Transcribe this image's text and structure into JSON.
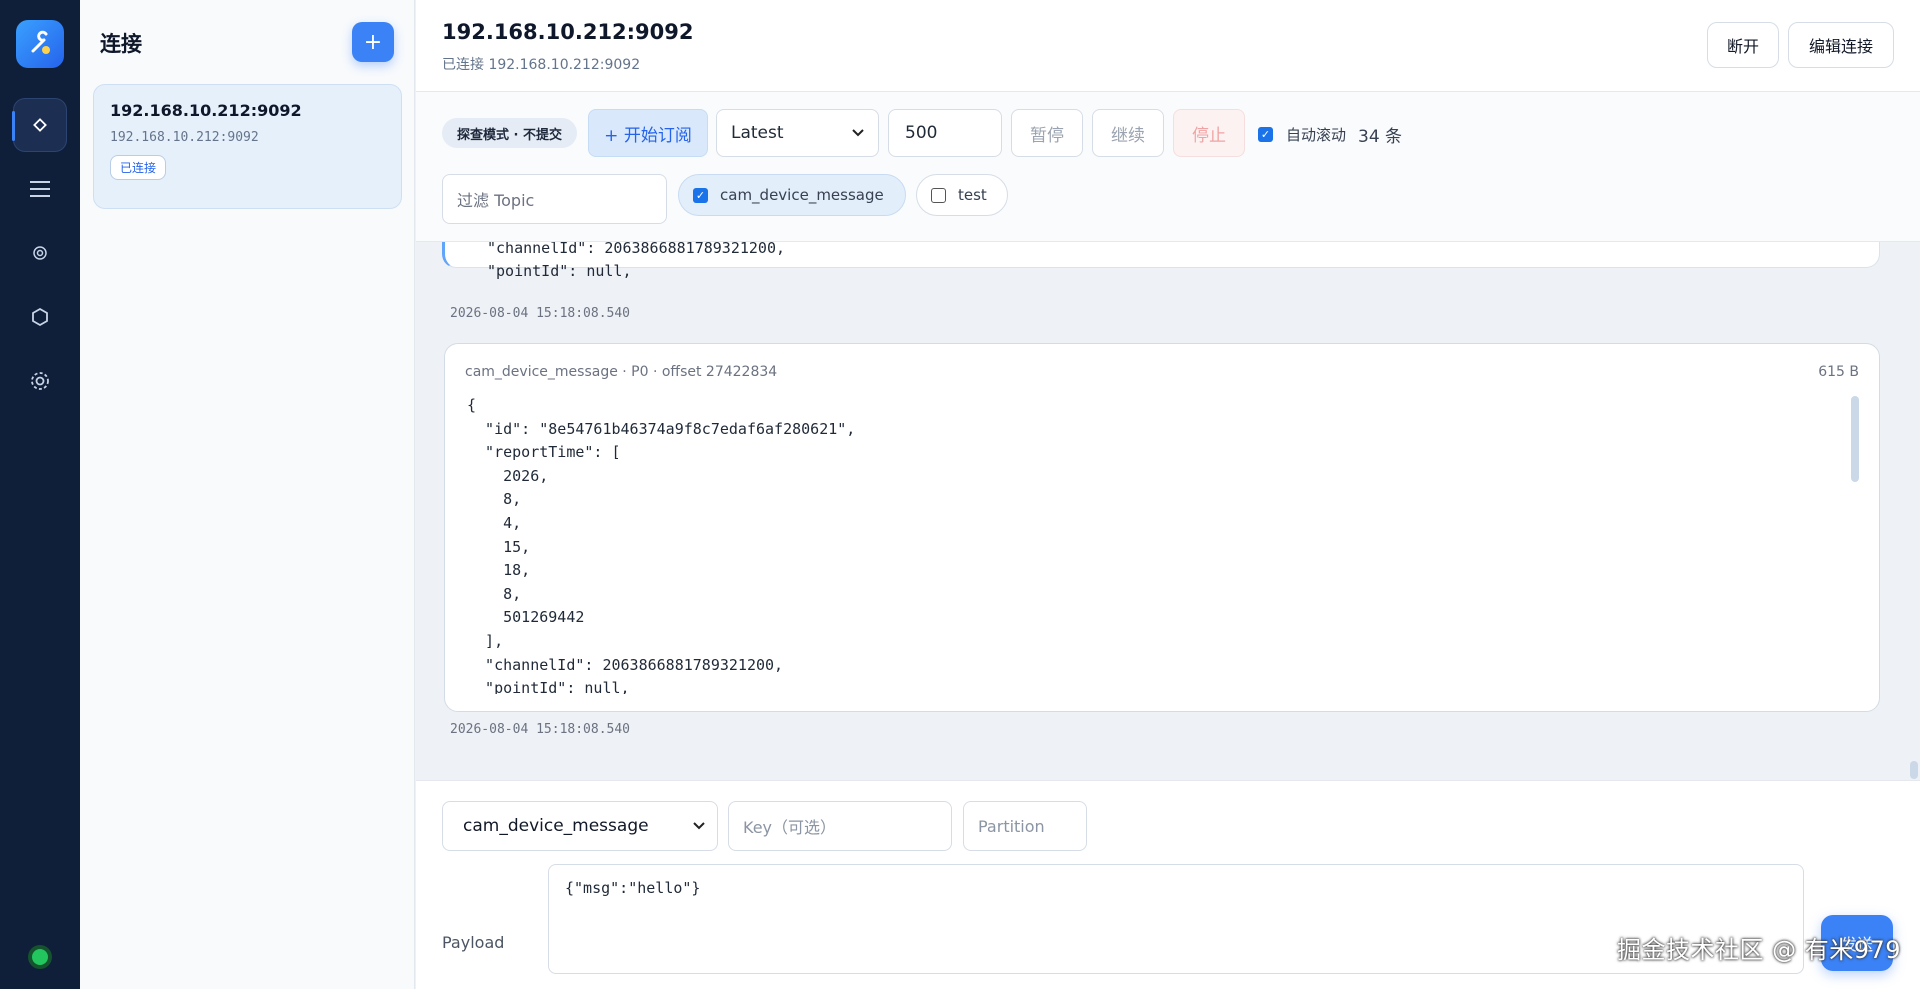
{
  "rail": {
    "items": [
      "connections-icon",
      "list-icon",
      "target-icon",
      "hexagon-icon",
      "settings-icon"
    ]
  },
  "sidebar": {
    "title": "连接",
    "add_label": "+",
    "connection": {
      "name": "192.168.10.212:9092",
      "address": "192.168.10.212:9092",
      "status": "已连接"
    }
  },
  "header": {
    "title": "192.168.10.212:9092",
    "subtitle": "已连接 192.168.10.212:9092",
    "disconnect_label": "断开",
    "edit_label": "编辑连接"
  },
  "toolbar": {
    "mode_label": "探查模式 · 不提交",
    "subscribe_label": "+ 开始订阅",
    "offset_option": "Latest",
    "limit_value": "500",
    "pause_label": "暂停",
    "resume_label": "继续",
    "stop_label": "停止",
    "auto_scroll_label": "自动滚动",
    "count_label": "34 条",
    "filter_placeholder": "过滤 Topic",
    "topics": [
      {
        "name": "cam_device_message",
        "checked": true
      },
      {
        "name": "test",
        "checked": false
      }
    ]
  },
  "messages": {
    "previous": {
      "tail": "\"channelId\": 2063866881789321200,\n\"pointId\": null,",
      "timestamp": "2026-08-04 15:18:08.540"
    },
    "current": {
      "meta": "cam_device_message · P0 · offset 27422834",
      "size": "615 B",
      "body": "{\n  \"id\": \"8e54761b46374a9f8c7edaf6af280621\",\n  \"reportTime\": [\n    2026,\n    8,\n    4,\n    15,\n    18,\n    8,\n    501269442\n  ],\n  \"channelId\": 2063866881789321200,\n  \"pointId\": null,",
      "timestamp": "2026-08-04 15:18:08.540"
    }
  },
  "composer": {
    "topic": "cam_device_message",
    "key_placeholder": "Key（可选）",
    "partition_placeholder": "Partition",
    "payload_label": "Payload",
    "payload_value": "{\"msg\":\"hello\"}",
    "send_label": "发送"
  },
  "watermark": "掘金技术社区 @ 有米979",
  "colors": {
    "accent": "#3b82f6",
    "rail_bg": "#0f1f3a",
    "status_online": "#22c55e"
  }
}
